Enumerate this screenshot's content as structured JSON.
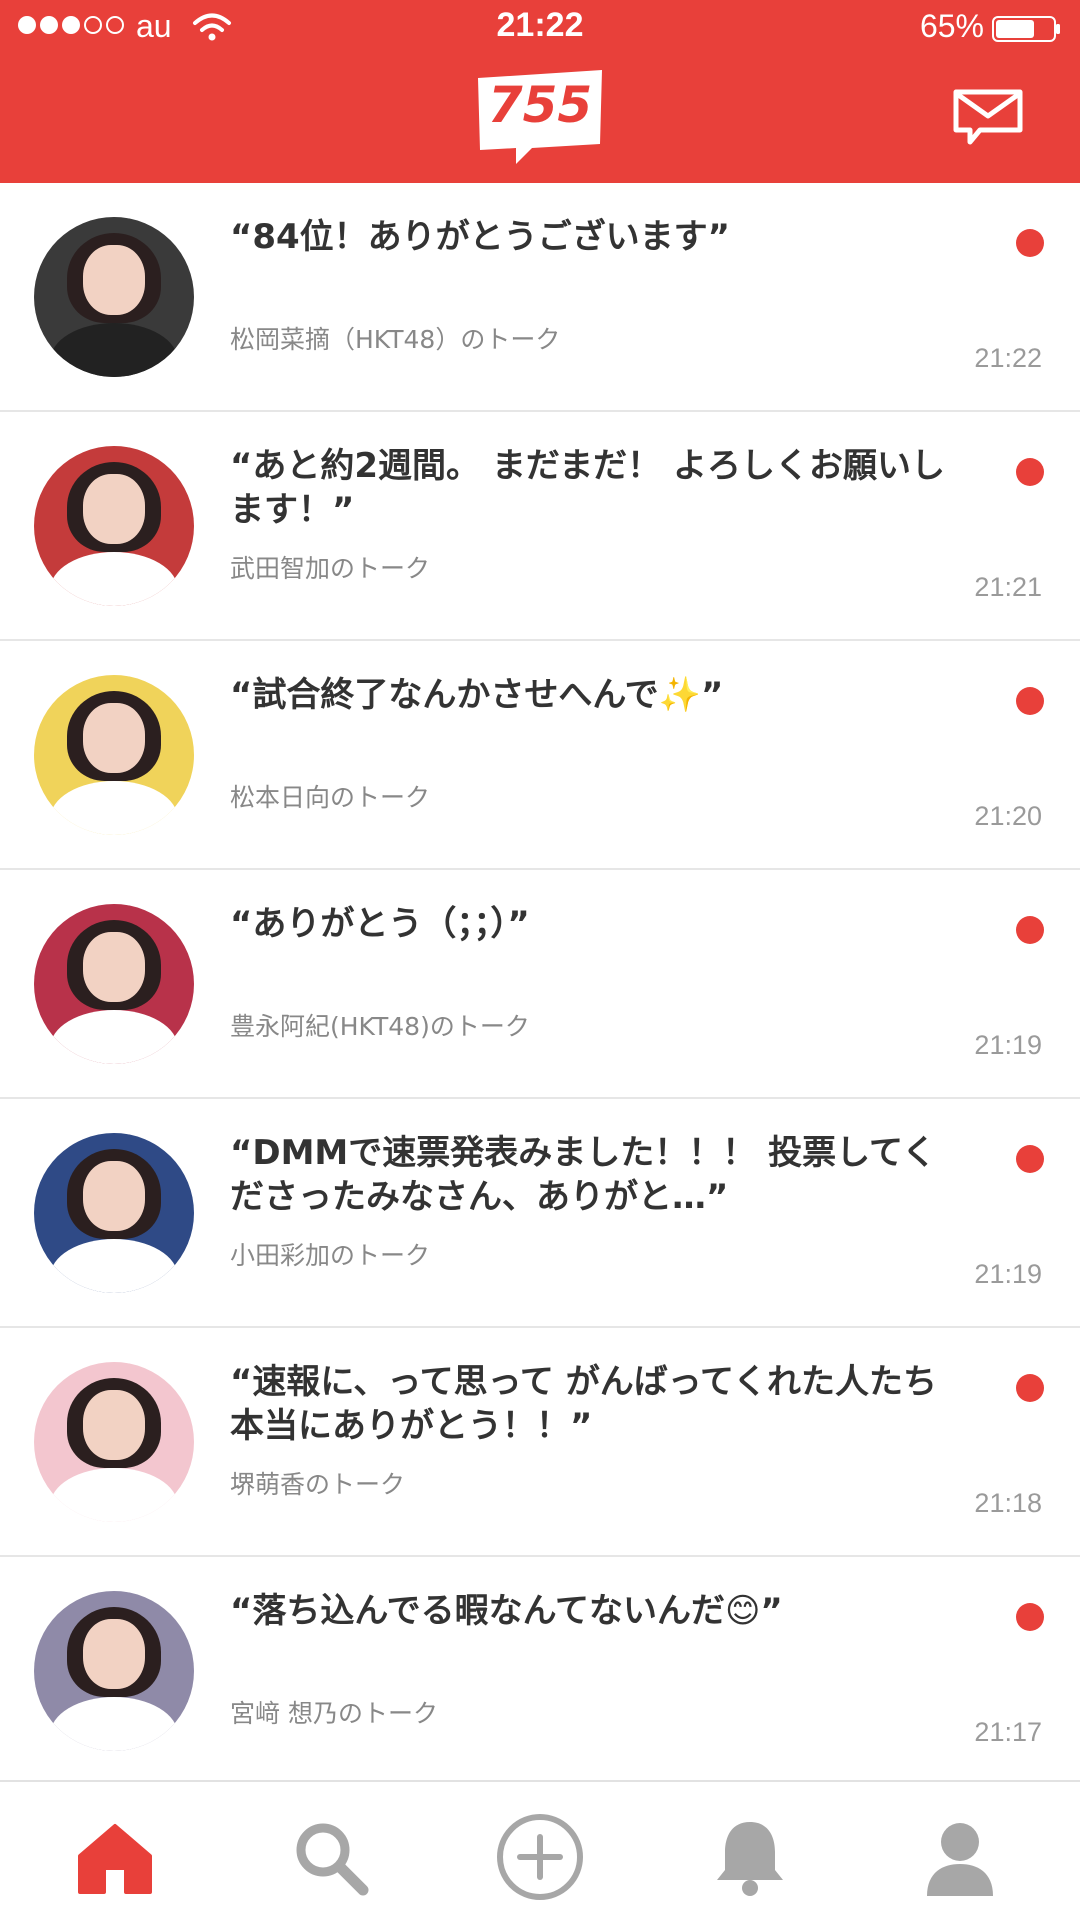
{
  "status_bar": {
    "carrier": "au",
    "time": "21:22",
    "battery": "65%"
  },
  "header": {
    "logo": "755",
    "mail_icon": "envelope-icon"
  },
  "feed": [
    {
      "message": "“84位！ありがとうございます”",
      "talk": "松岡菜摘（HKT48）のトーク",
      "time": "21:22",
      "avatar_color": "#3a3a3a"
    },
    {
      "message": "“あと約2週間。 まだまだ！ よろしくお願いし\nます！”",
      "talk": "武田智加のトーク",
      "time": "21:21",
      "avatar_color": "#c43b3b"
    },
    {
      "message": "“試合終了なんかさせへんで✨”",
      "talk": "松本日向のトーク",
      "time": "21:20",
      "avatar_color": "#f0d35a"
    },
    {
      "message": "“ありがとう（；；）”",
      "talk": "豊永阿紀(HKT48)のトーク",
      "time": "21:19",
      "avatar_color": "#b8324a"
    },
    {
      "message": "“DMMで速票発表みました！！！ 投票してく\nださったみなさん、ありがと…”",
      "talk": "小田彩加のトーク",
      "time": "21:19",
      "avatar_color": "#2f4a86"
    },
    {
      "message": "“速報に、って思って がんばってくれた人たち\n本当にありがとう！！”",
      "talk": "堺萌香のトーク",
      "time": "21:18",
      "avatar_color": "#f3c6cf"
    },
    {
      "message": "“落ち込んでる暇なんてないんだ😊”",
      "talk": "宮﨑 想乃のトーク",
      "time": "21:17",
      "avatar_color": "#8f8aa8"
    }
  ],
  "tabbar": {
    "items": [
      "home-icon",
      "search-icon",
      "add-icon",
      "bell-icon",
      "profile-icon"
    ],
    "active": "home-icon"
  },
  "colors": {
    "accent": "#e8403a",
    "text": "#333333",
    "muted": "#888888",
    "tab_inactive": "#a7a7a7"
  }
}
